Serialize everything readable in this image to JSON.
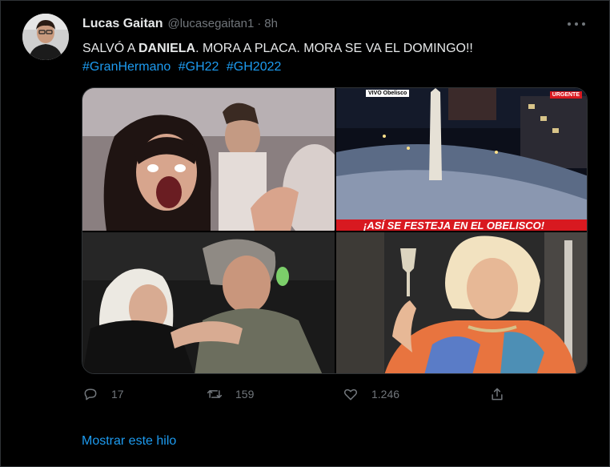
{
  "tweet": {
    "author_name": "Lucas Gaitan",
    "author_handle": "@lucasegaitan1",
    "separator": "·",
    "time": "8h",
    "text_part1": "SALVÓ A ",
    "text_bold": "DANIELA",
    "text_part2": ". MORA A PLACA. MORA SE VA EL DOMINGO!!",
    "hashtags": [
      "#GranHermano",
      "#GH22",
      "#GH2022"
    ]
  },
  "media": {
    "overlays": {
      "live_label": "VIVO Obelisco",
      "urgent_label": "URGENTE",
      "banner_text": "¡ASÍ SE FESTEJA EN EL OBELISCO!"
    }
  },
  "actions": {
    "replies": "17",
    "retweets": "159",
    "likes": "1.246"
  },
  "show_thread": "Mostrar este hilo",
  "colors": {
    "background": "#000000",
    "text": "#e7e9ea",
    "muted": "#71767b",
    "link": "#1d9bf0",
    "banner_red": "#d81920"
  },
  "icons": [
    "more-icon",
    "reply-icon",
    "retweet-icon",
    "like-icon",
    "share-icon"
  ]
}
